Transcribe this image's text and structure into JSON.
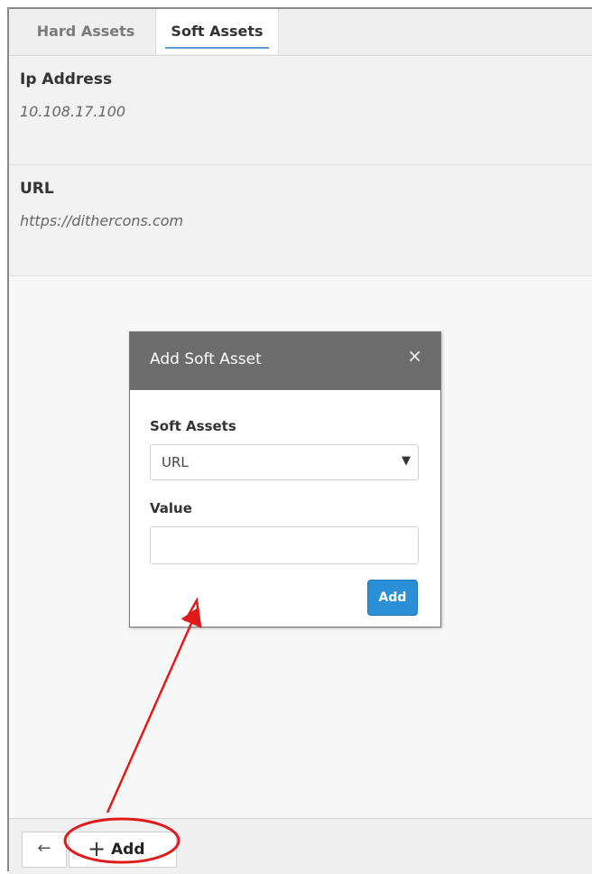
{
  "tabs": [
    {
      "label": "Hard Assets",
      "active": false
    },
    {
      "label": "Soft Assets",
      "active": true
    }
  ],
  "fields": {
    "ip": {
      "label": "Ip Address",
      "value": "10.108.17.100"
    },
    "url": {
      "label": "URL",
      "value": "https://dithercons.com"
    }
  },
  "modal": {
    "title": "Add Soft Asset",
    "close": "×",
    "soft_assets_label": "Soft Assets",
    "selected": "URL",
    "value_label": "Value",
    "value_text": "",
    "add_label": "Add"
  },
  "footer": {
    "back": "←",
    "add_label": "Add",
    "plus": "+"
  },
  "annotation": {
    "color": "#e01b1b"
  },
  "colors": {
    "accent": "#2a8fd6",
    "header": "#6c6c6c"
  }
}
